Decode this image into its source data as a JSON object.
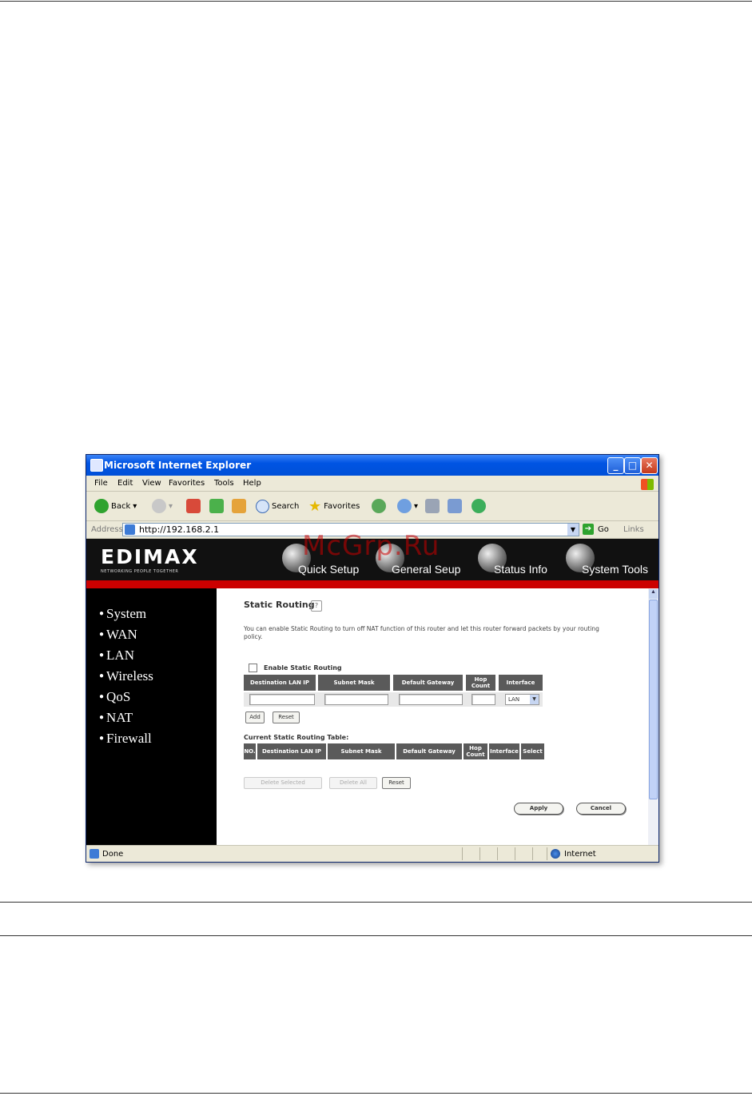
{
  "watermark": "McGrp.Ru",
  "browser": {
    "title": "Microsoft Internet Explorer",
    "menu": [
      "File",
      "Edit",
      "View",
      "Favorites",
      "Tools",
      "Help"
    ],
    "toolbar": {
      "back": "Back",
      "search": "Search",
      "favorites": "Favorites"
    },
    "address_label": "Address",
    "url": "http://192.168.2.1",
    "go": "Go",
    "links": "Links",
    "status": "Done",
    "zone": "Internet"
  },
  "router": {
    "logo": "EDIMAX",
    "tagline": "NETWORKING PEOPLE TOGETHER",
    "nav": [
      "Quick Setup",
      "General Seup",
      "Status Info",
      "System Tools"
    ],
    "sidebar": [
      "System",
      "WAN",
      "LAN",
      "Wireless",
      "QoS",
      "NAT",
      "Firewall"
    ],
    "section_title": "Static Routing",
    "description": "You can enable Static Routing to turn off NAT function of this router and let this router forward packets by your routing policy.",
    "enable_label": "Enable Static Routing",
    "add_table": {
      "headers": [
        "Destination LAN IP",
        "Subnet Mask",
        "Default Gateway",
        "Hop Count",
        "Interface"
      ],
      "interface_value": "LAN"
    },
    "add_button": "Add",
    "reset_button": "Reset",
    "current_title": "Current Static Routing Table:",
    "current_headers": [
      "NO.",
      "Destination LAN IP",
      "Subnet Mask",
      "Default Gateway",
      "Hop Count",
      "Interface",
      "Select"
    ],
    "delete_selected": "Delete Selected",
    "delete_all": "Delete All",
    "reset2": "Reset",
    "apply": "Apply",
    "cancel": "Cancel"
  }
}
